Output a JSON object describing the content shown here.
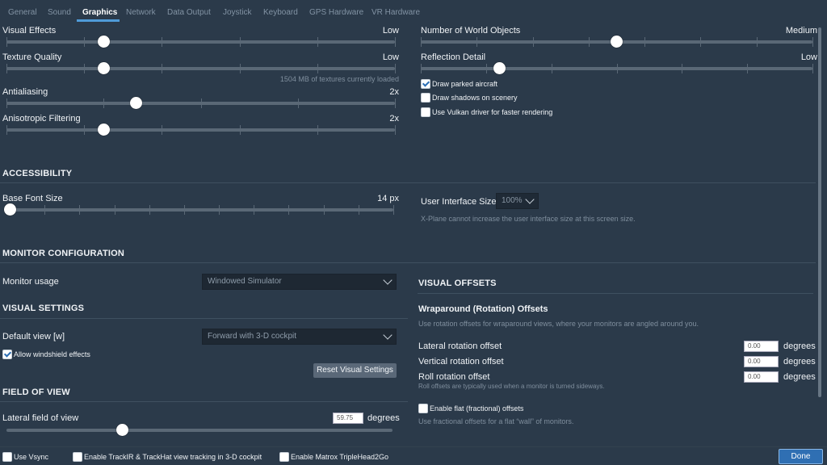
{
  "tabs": [
    {
      "label": "General"
    },
    {
      "label": "Sound"
    },
    {
      "label": "Graphics"
    },
    {
      "label": "Network"
    },
    {
      "label": "Data Output"
    },
    {
      "label": "Joystick"
    },
    {
      "label": "Keyboard"
    },
    {
      "label": "GPS Hardware"
    },
    {
      "label": "VR Hardware"
    }
  ],
  "active_tab": "Graphics",
  "graphics": {
    "visual_effects": {
      "label": "Visual Effects",
      "value": "Low",
      "level": 0.25
    },
    "texture_quality": {
      "label": "Texture Quality",
      "value": "Low",
      "level": 0.25,
      "note": "1504 MB of textures currently loaded"
    },
    "antialiasing": {
      "label": "Antialiasing",
      "value": "2x",
      "level": 0.333
    },
    "anisotropic": {
      "label": "Anisotropic Filtering",
      "value": "2x",
      "level": 0.25
    },
    "world_objects": {
      "label": "Number of World Objects",
      "value": "Medium",
      "level": 0.5
    },
    "reflection_detail": {
      "label": "Reflection Detail",
      "value": "Low",
      "level": 0.2
    },
    "draw_parked": {
      "label": "Draw parked aircraft",
      "checked": true
    },
    "draw_shadows": {
      "label": "Draw shadows on scenery",
      "checked": false
    },
    "use_vulkan": {
      "label": "Use Vulkan driver for faster rendering",
      "checked": false
    }
  },
  "accessibility": {
    "heading": "ACCESSIBILITY",
    "base_font": {
      "label": "Base Font Size",
      "value": "14 px",
      "level": 0.0
    },
    "ui_size": {
      "label": "User Interface Size",
      "value": "100%",
      "note": "X-Plane cannot increase the user interface size at this screen size."
    }
  },
  "monitor": {
    "heading": "MONITOR CONFIGURATION",
    "usage_label": "Monitor usage",
    "usage_value": "Windowed Simulator"
  },
  "visual_settings": {
    "heading": "VISUAL SETTINGS",
    "default_view_label": "Default view [w]",
    "default_view_value": "Forward with 3-D cockpit",
    "windshield": {
      "label": "Allow windshield effects",
      "checked": true
    },
    "reset_button": "Reset Visual Settings"
  },
  "field_of_view": {
    "heading": "FIELD OF VIEW",
    "lateral_label": "Lateral field of view",
    "lateral_value": "59.75",
    "unit": "degrees",
    "level": 0.3
  },
  "visual_offsets": {
    "heading": "VISUAL OFFSETS",
    "wrap_heading": "Wraparound (Rotation) Offsets",
    "wrap_note": "Use rotation offsets for wraparound views, where your monitors are angled around you.",
    "lateral": {
      "label": "Lateral rotation offset",
      "value": "0.00",
      "unit": "degrees"
    },
    "vertical": {
      "label": "Vertical rotation offset",
      "value": "0.00",
      "unit": "degrees"
    },
    "roll": {
      "label": "Roll rotation offset",
      "value": "0.00",
      "unit": "degrees",
      "note": "Roll offsets are typically used when a monitor is turned sideways."
    },
    "flat": {
      "label": "Enable flat (fractional) offsets",
      "checked": false,
      "note": "Use fractional offsets for a flat “wall” of monitors."
    }
  },
  "footer": {
    "vsync": {
      "label": "Use Vsync",
      "checked": false
    },
    "trackir": {
      "label": "Enable TrackIR & TrackHat view tracking in 3-D cockpit",
      "checked": false
    },
    "matrox": {
      "label": "Enable Matrox TripleHead2Go",
      "checked": false
    },
    "done": "Done"
  },
  "colors": {
    "background": "#2b3a4a",
    "accent": "#4f9bd8",
    "done_button": "#2f6fb3"
  }
}
